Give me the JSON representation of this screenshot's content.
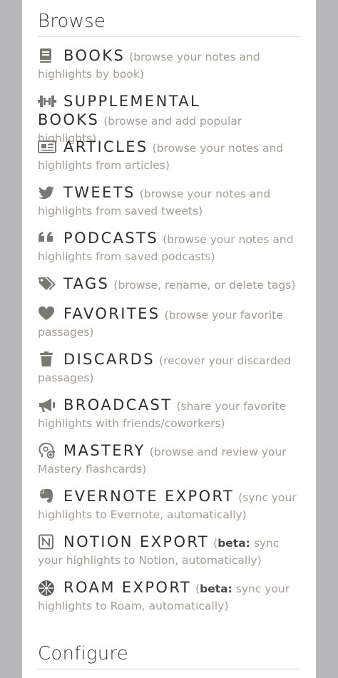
{
  "browse": {
    "title": "Browse",
    "items": [
      {
        "label": "BOOKS",
        "desc": "(browse your notes and highlights by book)",
        "icon": "book-icon"
      },
      {
        "label": "SUPPLEMENTAL BOOKS",
        "desc": "(browse and add popular highlights)",
        "icon": "dumbbell-icon"
      },
      {
        "label": "ARTICLES",
        "desc": "(browse your notes and highlights from articles)",
        "icon": "newspaper-icon"
      },
      {
        "label": "TWEETS",
        "desc": "(browse your notes and highlights from saved tweets)",
        "icon": "twitter-icon"
      },
      {
        "label": "PODCASTS",
        "desc": "(browse your notes and highlights from saved podcasts)",
        "icon": "quote-icon"
      },
      {
        "label": "TAGS",
        "desc": "(browse, rename, or delete tags)",
        "icon": "tags-icon"
      },
      {
        "label": "FAVORITES",
        "desc": "(browse your favorite passages)",
        "icon": "heart-icon"
      },
      {
        "label": "DISCARDS",
        "desc": "(recover your discarded passages)",
        "icon": "trash-icon"
      },
      {
        "label": "BROADCAST",
        "desc": "(share your favorite highlights with friends/coworkers)",
        "icon": "megaphone-icon"
      },
      {
        "label": "MASTERY",
        "desc": "(browse and review your Mastery flashcards)",
        "icon": "brain-icon"
      },
      {
        "label": "EVERNOTE EXPORT",
        "desc": "(sync your highlights to Evernote, automatically)",
        "icon": "evernote-icon"
      },
      {
        "label": "NOTION EXPORT",
        "desc_open": "(",
        "beta": "beta:",
        "desc": "sync your highlights to Notion, automatically)",
        "icon": "notion-icon"
      },
      {
        "label": "ROAM EXPORT",
        "desc_open": "(",
        "beta": "beta:",
        "desc": "sync your highlights to Roam, automatically)",
        "icon": "roam-icon"
      }
    ]
  },
  "configure": {
    "title": "Configure"
  },
  "colors": {
    "background": "#b8b7bc",
    "panel": "#ffffff",
    "label": "#2f2f2f",
    "description": "#a59c93",
    "icon": "#7d7772"
  }
}
